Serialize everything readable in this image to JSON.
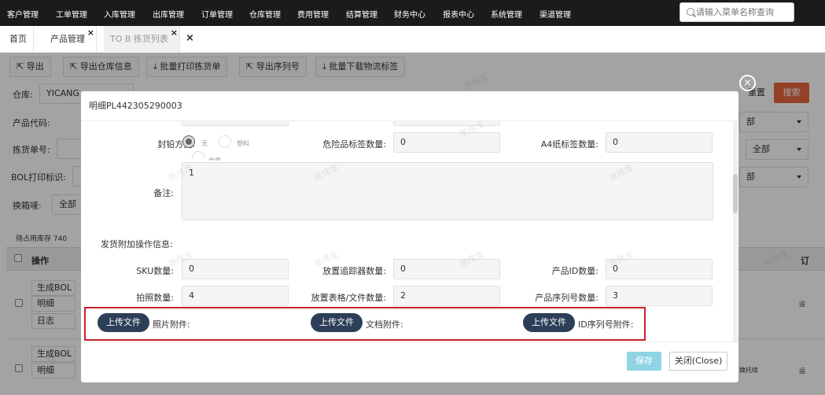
{
  "topnav": {
    "menu": [
      "客户管理",
      "工单管理",
      "入库管理",
      "出库管理",
      "订单管理",
      "仓库管理",
      "费用管理",
      "结算管理",
      "财务中心",
      "报表中心",
      "系统管理",
      "渠道管理"
    ],
    "search_placeholder": "请输入菜单名称查询"
  },
  "tabs": [
    {
      "label": "首页"
    },
    {
      "label": "产品管理"
    },
    {
      "label": "TO B 拣货列表"
    }
  ],
  "toolbar": {
    "export": "导出",
    "export_warehouse": "导出仓库信息",
    "batch_print": "批量打印拣货单",
    "export_serial": "导出序列号",
    "batch_download": "批量下载物流标签"
  },
  "filters": {
    "warehouse_label": "仓库:",
    "warehouse_value": "YICANG",
    "product_code_label": "产品代码:",
    "pick_no_label": "拣货单号:",
    "bol_label": "BOL打印标识:",
    "box_label": "换箱唛:",
    "box_value": "全部",
    "all_value": "全部",
    "right_value_1": "部",
    "right_value_2": "部",
    "reset": "重置",
    "search": "搜索"
  },
  "table": {
    "stock_note": "待占用库存 740",
    "col_action": "操作",
    "col_order": "订",
    "row1_btns": [
      "生成BOL",
      "明细",
      "日志"
    ],
    "row2_btns": [
      "生成BOL",
      "明细"
    ],
    "row1_tail": "运",
    "row2_tail": "运",
    "row2_mid": "换托续"
  },
  "watermark": "张伟龙",
  "modal": {
    "title": "明细PL442305290003",
    "seal_label": "封铅方式:",
    "seal_options": [
      "无",
      "塑料",
      "金属"
    ],
    "danger_label": "危险品标签数量:",
    "danger_value": "0",
    "a4_label": "A4纸标签数量:",
    "a4_value": "0",
    "remark_label": "备注:",
    "remark_value": "1",
    "section": "发货附加操作信息:",
    "sku_label": "SKU数量:",
    "sku_value": "0",
    "tracker_label": "放置追踪器数量:",
    "tracker_value": "0",
    "pid_label": "产品ID数量:",
    "pid_value": "0",
    "photo_label": "拍照数量:",
    "photo_value": "4",
    "form_label": "放置表格/文件数量:",
    "form_value": "2",
    "serial_label": "产品序列号数量:",
    "serial_value": "3",
    "upload_btn": "上传文件",
    "photo_attach": "照片附件:",
    "doc_attach": "文档附件:",
    "id_attach": "ID序列号附件:",
    "save": "保存",
    "close": "关闭(Close)",
    "close_icon": "×"
  }
}
